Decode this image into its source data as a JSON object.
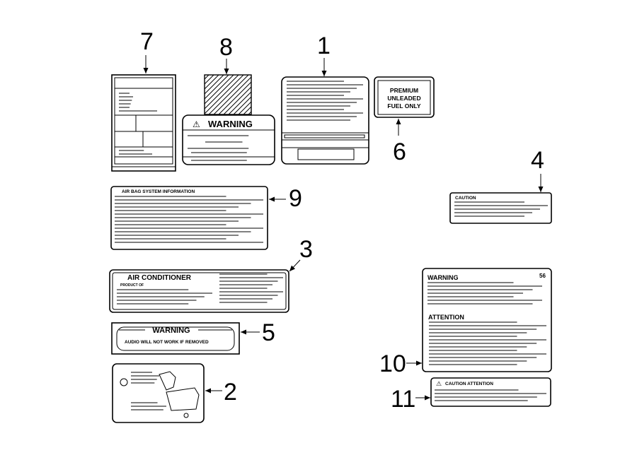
{
  "callouts": {
    "n1": "1",
    "n2": "2",
    "n3": "3",
    "n4": "4",
    "n5": "5",
    "n6": "6",
    "n7": "7",
    "n8": "8",
    "n9": "9",
    "n10": "10",
    "n11": "11"
  },
  "labels": {
    "warning_8": "WARNING",
    "fuel_line1": "PREMIUM",
    "fuel_line2": "UNLEADED",
    "fuel_line3": "FUEL ONLY",
    "airbag_title": "AIR BAG SYSTEM INFORMATION",
    "caution_4": "CAUTION",
    "ac_title": "AIR CONDITIONER",
    "ac_product": "PRODUCT OF",
    "warning_10": "WARNING",
    "attention_10": "ATTENTION",
    "code_10": "56",
    "warning_5": "WARNING",
    "audio_5": "AUDIO WILL NOT WORK IF REMOVED",
    "caution_attention_11": "CAUTION ATTENTION"
  },
  "icons": {
    "warning": "warning-triangle-icon",
    "arrow": "arrow-icon"
  }
}
